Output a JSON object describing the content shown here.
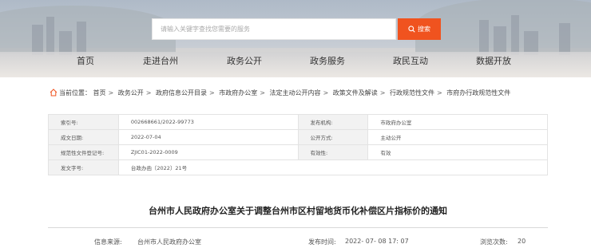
{
  "search": {
    "placeholder": "请输入关键字查找您需要的服务",
    "button_label": "搜索"
  },
  "nav": [
    "首页",
    "走进台州",
    "政务公开",
    "政务服务",
    "政民互动",
    "数据开放"
  ],
  "breadcrumb": {
    "prefix": "当前位置：",
    "items": [
      "首页",
      "政务公开",
      "政府信息公开目录",
      "市政府办公室",
      "法定主动公开内容",
      "政策文件及解读",
      "行政规范性文件",
      "市府办行政规范性文件"
    ]
  },
  "info_table": [
    {
      "k1": "索引号:",
      "v1": "002668661/2022-99773",
      "k2": "发布机构:",
      "v2": "市政府办公室"
    },
    {
      "k1": "成文日期:",
      "v1": "2022-07-04",
      "k2": "公开方式:",
      "v2": "主动公开"
    },
    {
      "k1": "规范性文件登记号:",
      "v1": "ZJIC01-2022-0009",
      "k2": "有效性:",
      "v2": "有效"
    },
    {
      "k1": "发文字号:",
      "v1": "台政办函〔2022〕21号"
    }
  ],
  "article": {
    "title": "台州市人民政府办公室关于调整台州市区村留地货币化补偿区片指标价的通知",
    "source_label": "信息来源:",
    "source": "台州市人民政府办公室",
    "published_label": "发布时间:",
    "published": "2022- 07- 08 17: 07",
    "views_label": "浏览次数:",
    "views": "20"
  },
  "colors": {
    "accent": "#f0531f"
  }
}
